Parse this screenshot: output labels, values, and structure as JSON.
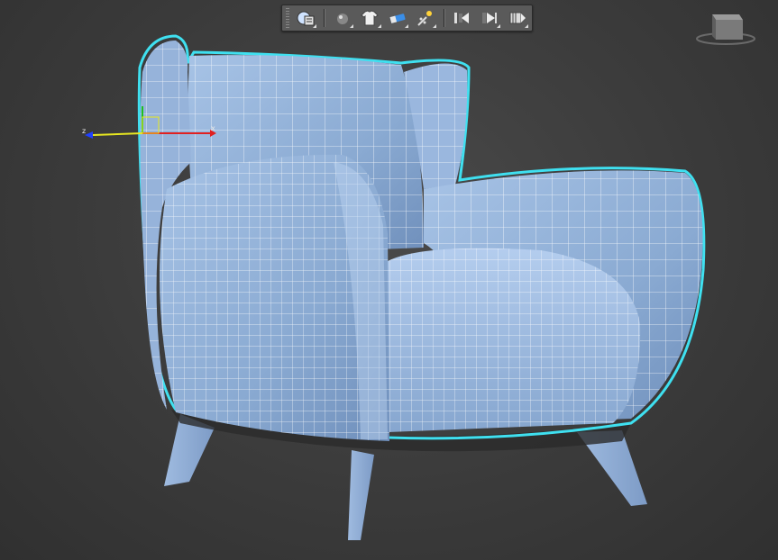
{
  "toolbar": {
    "buttons": [
      {
        "name": "render-setup-icon",
        "flyout": true
      },
      {
        "name": "sphere-material-icon",
        "flyout": true
      },
      {
        "name": "tshirt-icon",
        "flyout": true
      },
      {
        "name": "eraser-icon",
        "flyout": true
      },
      {
        "name": "magic-sparkle-icon",
        "flyout": true
      },
      {
        "name": "step-back-icon",
        "flyout": false
      },
      {
        "name": "step-forward-icon",
        "flyout": true
      },
      {
        "name": "filmstrip-icon",
        "flyout": true
      }
    ]
  },
  "gizmo": {
    "x_label": "x",
    "y_label": "y",
    "z_label": "z",
    "colors": {
      "x": "#e02020",
      "y": "#20c020",
      "z": "#2040ff",
      "selected": "#e8e820"
    }
  },
  "viewport": {
    "background": "#3b3b3b",
    "mesh_color": "#8fb1d9",
    "wire_color": "#ffffff",
    "selection_outline": "#3fe0f0"
  }
}
